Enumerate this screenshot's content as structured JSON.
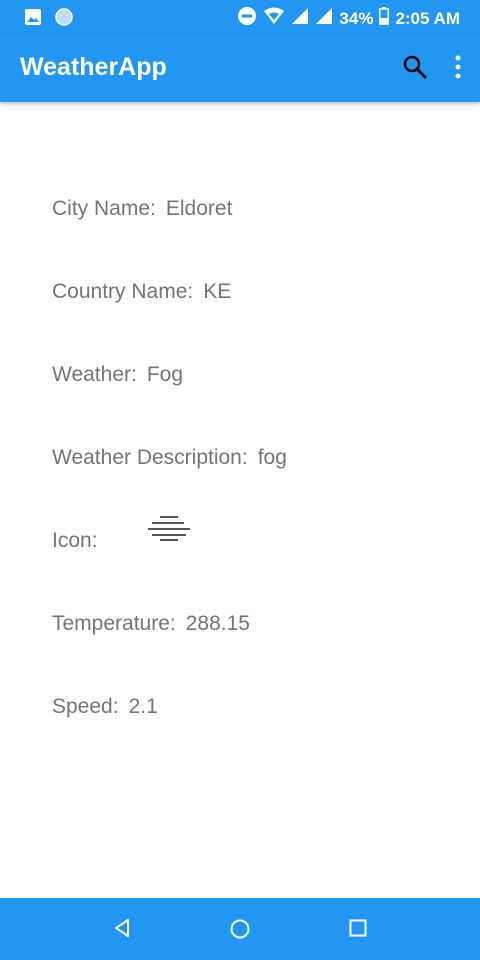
{
  "status_bar": {
    "battery": "34%",
    "time": "2:05 AM",
    "icons": [
      "image-icon",
      "circle-icon",
      "do-not-disturb-icon",
      "wifi-icon",
      "signal-icon",
      "signal-icon",
      "battery-icon"
    ]
  },
  "app_bar": {
    "title": "WeatherApp",
    "icons": [
      "search-icon",
      "overflow-menu-icon"
    ]
  },
  "fields": {
    "city": {
      "label": "City Name:",
      "value": "Eldoret"
    },
    "country": {
      "label": "Country Name:",
      "value": "KE"
    },
    "weather": {
      "label": "Weather:",
      "value": "Fog"
    },
    "description": {
      "label": "Weather Description:",
      "value": "fog"
    },
    "icon": {
      "label": "Icon:",
      "icon": "fog-icon"
    },
    "temperature": {
      "label": "Temperature:",
      "value": "288.15"
    },
    "speed": {
      "label": "Speed:",
      "value": "2.1"
    }
  },
  "nav_bar": {
    "icons": [
      "back-icon",
      "home-icon",
      "recents-icon"
    ]
  },
  "colors": {
    "primary": "#2196f3",
    "text": "#757575"
  }
}
